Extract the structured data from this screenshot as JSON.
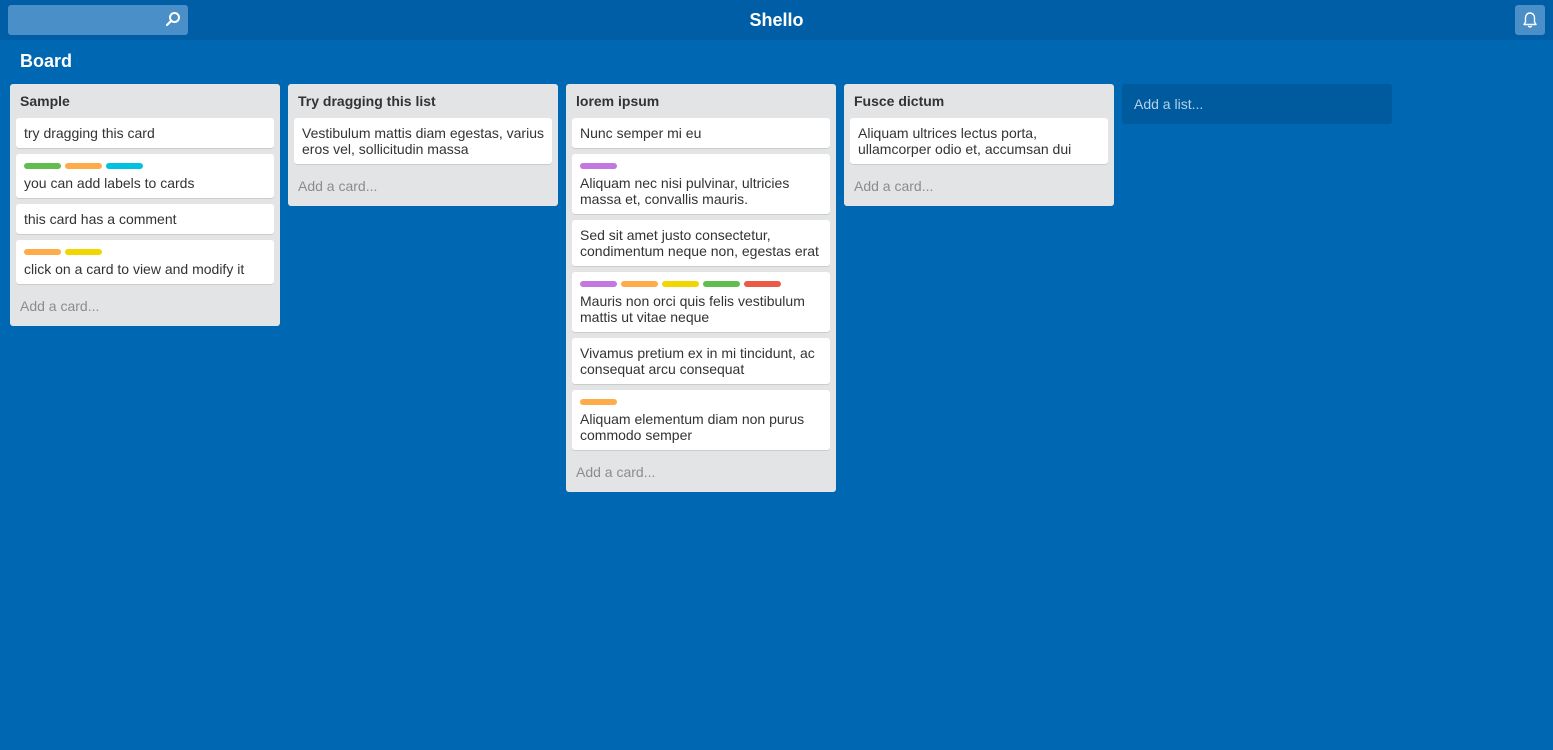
{
  "app": {
    "title": "Shello"
  },
  "search": {
    "placeholder": ""
  },
  "board": {
    "title": "Board"
  },
  "colors": {
    "green": "#61bd4f",
    "orange": "#ffab4a",
    "cyan": "#00c2e0",
    "yellow": "#f2d600",
    "purple": "#c377e0",
    "red": "#eb5a46"
  },
  "lists": [
    {
      "title": "Sample",
      "cards": [
        {
          "text": "try dragging this card",
          "labels": []
        },
        {
          "text": "you can add labels to cards",
          "labels": [
            "green",
            "orange",
            "cyan"
          ]
        },
        {
          "text": "this card has a comment",
          "labels": []
        },
        {
          "text": "click on a card to view and modify it",
          "labels": [
            "orange",
            "yellow"
          ]
        }
      ],
      "add_card": "Add a card..."
    },
    {
      "title": "Try dragging this list",
      "cards": [
        {
          "text": "Vestibulum mattis diam egestas, varius eros vel, sollicitudin massa",
          "labels": []
        }
      ],
      "add_card": "Add a card..."
    },
    {
      "title": "lorem ipsum",
      "cards": [
        {
          "text": "Nunc semper mi eu",
          "labels": []
        },
        {
          "text": "Aliquam nec nisi pulvinar, ultricies massa et, convallis mauris.",
          "labels": [
            "purple"
          ]
        },
        {
          "text": "Sed sit amet justo consectetur, condimentum neque non, egestas erat",
          "labels": []
        },
        {
          "text": "Mauris non orci quis felis vestibulum mattis ut vitae neque",
          "labels": [
            "purple",
            "orange",
            "yellow",
            "green",
            "red"
          ]
        },
        {
          "text": "Vivamus pretium ex in mi tincidunt, ac consequat arcu consequat",
          "labels": []
        },
        {
          "text": "Aliquam elementum diam non purus commodo semper",
          "labels": [
            "orange"
          ]
        }
      ],
      "add_card": "Add a card..."
    },
    {
      "title": "Fusce dictum",
      "cards": [
        {
          "text": "Aliquam ultrices lectus porta, ullamcorper odio et, accumsan dui",
          "labels": []
        }
      ],
      "add_card": "Add a card..."
    }
  ],
  "add_list": "Add a list..."
}
